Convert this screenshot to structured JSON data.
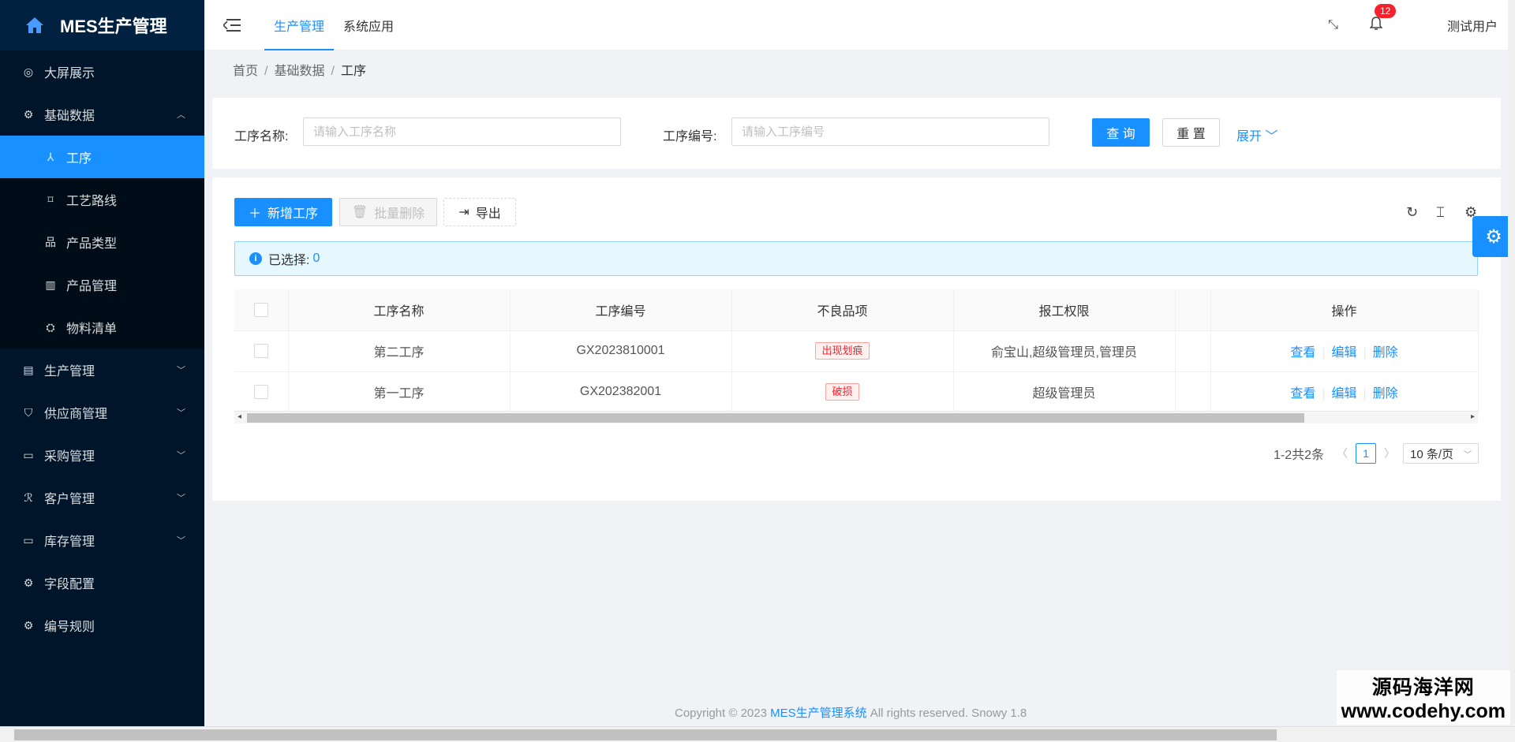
{
  "app": {
    "title": "MES生产管理"
  },
  "sidebar": {
    "items": [
      {
        "label": "大屏展示",
        "icon": "dashboard-icon"
      },
      {
        "label": "基础数据",
        "icon": "gear-icon",
        "expanded": true
      },
      {
        "label": "生产管理",
        "icon": "document-icon"
      },
      {
        "label": "供应商管理",
        "icon": "shield-icon"
      },
      {
        "label": "采购管理",
        "icon": "calendar-icon"
      },
      {
        "label": "客户管理",
        "icon": "users-icon"
      },
      {
        "label": "库存管理",
        "icon": "monitor-icon"
      },
      {
        "label": "字段配置",
        "icon": "gear-icon"
      },
      {
        "label": "编号规则",
        "icon": "gear-icon"
      }
    ],
    "submenu": [
      {
        "label": "工序",
        "icon": "cluster-icon",
        "active": true
      },
      {
        "label": "工艺路线",
        "icon": "route-icon"
      },
      {
        "label": "产品类型",
        "icon": "category-icon"
      },
      {
        "label": "产品管理",
        "icon": "barcode-icon"
      },
      {
        "label": "物料清单",
        "icon": "bom-icon"
      }
    ]
  },
  "header": {
    "tabs": [
      {
        "label": "生产管理",
        "active": true
      },
      {
        "label": "系统应用"
      }
    ],
    "notification_count": "12",
    "user": "测试用户"
  },
  "breadcrumb": {
    "items": [
      "首页",
      "基础数据",
      "工序"
    ]
  },
  "search": {
    "name_label": "工序名称:",
    "name_placeholder": "请输入工序名称",
    "code_label": "工序编号:",
    "code_placeholder": "请输入工序编号",
    "query_label": "查 询",
    "reset_label": "重 置",
    "expand_label": "展开"
  },
  "toolbar": {
    "add_label": "新增工序",
    "batch_delete_label": "批量删除",
    "export_label": "导出"
  },
  "selection": {
    "label": "已选择:",
    "count": "0"
  },
  "table": {
    "columns": [
      "工序名称",
      "工序编号",
      "不良品项",
      "报工权限",
      "操作"
    ],
    "rows": [
      {
        "name": "第二工序",
        "code": "GX2023810001",
        "defect": "出现划痕",
        "permission": "俞宝山,超级管理员,管理员"
      },
      {
        "name": "第一工序",
        "code": "GX202382001",
        "defect": "破损",
        "permission": "超级管理员"
      }
    ],
    "actions": {
      "view": "查看",
      "edit": "编辑",
      "delete": "删除"
    }
  },
  "pagination": {
    "summary": "1-2共2条",
    "current": "1",
    "page_size": "10 条/页"
  },
  "footer": {
    "prefix": "Copyright © 2023 ",
    "brand": "MES生产管理系统",
    "suffix": " All rights reserved. Snowy 1.8"
  },
  "watermark": {
    "line1": "源码海洋网",
    "line2": "www.codehy.com"
  },
  "colors": {
    "primary": "#1890ff",
    "sidebar_bg": "#001529",
    "danger": "#f5222d"
  }
}
